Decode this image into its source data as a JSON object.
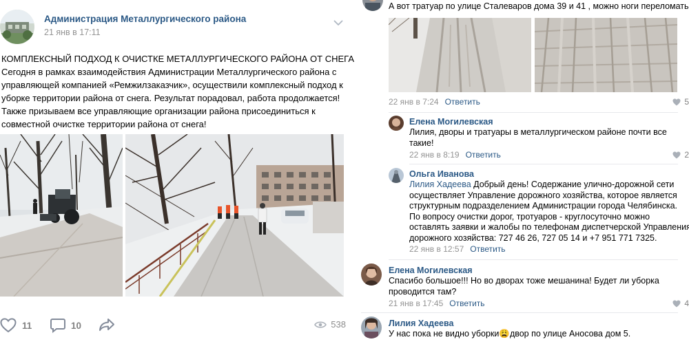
{
  "post": {
    "group_name": "Администрация Металлургического района",
    "date": "21 янв в 17:11",
    "text_lines": [
      "КОМПЛЕКСНЫЙ ПОДХОД К ОЧИСТКЕ МЕТАЛЛУРГИЧЕСКОГО РАЙОНА ОТ СНЕГА",
      "Сегодня в рамках взаимодействия Администрации Металлургического района с",
      "управляющей компанией «Ремжилзаказчик», осуществили комплексный подход к",
      "уборке территории района от снега. Результат порадовал, работа продолжается!",
      "Также призываем все управляющие организации района присоединиться к",
      "совместной очистке территории района от снега!"
    ],
    "likes": "11",
    "comments": "10",
    "views": "538"
  },
  "comments": [
    {
      "text": "А вот тратуар по улице Сталеваров дома 39 и 41 , можно ноги переломать",
      "date": "22 янв в 7:24",
      "reply_label": "Ответить",
      "likes": "5"
    },
    {
      "author": "Елена Могилевская",
      "text_lines": [
        "Лилия, дворы и тратуары в металлургическом районе почти все",
        "такие!"
      ],
      "date": "22 янв в 8:19",
      "reply_label": "Ответить",
      "likes": "2"
    },
    {
      "author": "Ольга Иванова",
      "reply_to": "Лилия Хадеева",
      "first_line_rest": " Добрый день! Содержание улично-дорожной сети",
      "text_lines": [
        "осуществляет Управление дорожного хозяйства, которое является",
        "структурным подразделением Администрации города Челябинска.",
        "По вопросу очистки дорог, тротуаров - круглосуточно можно",
        "оставлять заявки и жалобы по телефонам диспетчерской Управления",
        "дорожного хозяйства: 727 46 26, 727 05 14 и +7 951 771 7325."
      ],
      "date": "22 янв в 12:57",
      "reply_label": "Ответить"
    },
    {
      "author": "Елена Могилевская",
      "text_lines": [
        "Спасибо большое!!! Но во дворах тоже мешанина! Будет ли уборка",
        "проводится там?"
      ],
      "date": "21 янв в 17:45",
      "reply_label": "Ответить",
      "likes": "4"
    },
    {
      "author": "Лилия Хадеева",
      "text_before_emoji": "У нас пока не видно уборки",
      "emoji": "😩",
      "text_after_emoji": "двор по улице Аносова дом 5."
    }
  ],
  "colors": {
    "link": "#2a5885",
    "meta": "#939393",
    "icon": "#828282"
  }
}
